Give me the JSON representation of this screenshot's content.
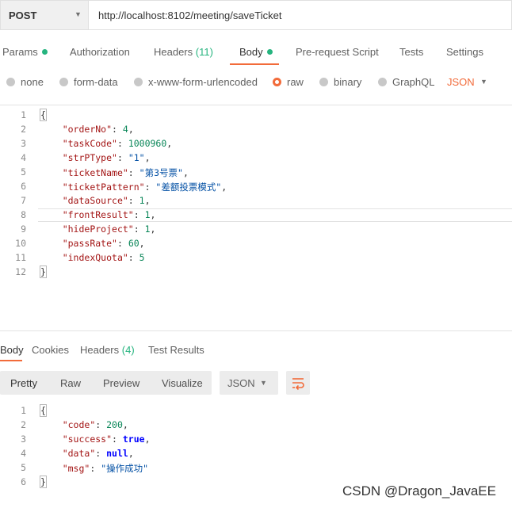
{
  "request": {
    "method": "POST",
    "url": "http://localhost:8102/meeting/saveTicket"
  },
  "tabs": {
    "params": "Params",
    "authorization": "Authorization",
    "headers_label": "Headers",
    "headers_count": "(11)",
    "body": "Body",
    "prerequest": "Pre-request Script",
    "tests": "Tests",
    "settings": "Settings"
  },
  "body_types": {
    "none": "none",
    "form_data": "form-data",
    "urlencoded": "x-www-form-urlencoded",
    "raw": "raw",
    "binary": "binary",
    "graphql": "GraphQL",
    "selected": "raw",
    "format": "JSON"
  },
  "request_body": [
    {
      "n": "1",
      "tokens": [
        {
          "t": "{",
          "c": "tk-p",
          "box": true
        }
      ]
    },
    {
      "n": "2",
      "tokens": [
        {
          "t": "    ",
          "c": "tk-p"
        },
        {
          "t": "\"orderNo\"",
          "c": "tk-key"
        },
        {
          "t": ": ",
          "c": "tk-p"
        },
        {
          "t": "4",
          "c": "tk-num"
        },
        {
          "t": ",",
          "c": "tk-p"
        }
      ]
    },
    {
      "n": "3",
      "tokens": [
        {
          "t": "    ",
          "c": "tk-p"
        },
        {
          "t": "\"taskCode\"",
          "c": "tk-key"
        },
        {
          "t": ": ",
          "c": "tk-p"
        },
        {
          "t": "1000960",
          "c": "tk-num"
        },
        {
          "t": ",",
          "c": "tk-p"
        }
      ]
    },
    {
      "n": "4",
      "tokens": [
        {
          "t": "    ",
          "c": "tk-p"
        },
        {
          "t": "\"strPType\"",
          "c": "tk-key"
        },
        {
          "t": ": ",
          "c": "tk-p"
        },
        {
          "t": "\"1\"",
          "c": "tk-str"
        },
        {
          "t": ",",
          "c": "tk-p"
        }
      ]
    },
    {
      "n": "5",
      "tokens": [
        {
          "t": "    ",
          "c": "tk-p"
        },
        {
          "t": "\"ticketName\"",
          "c": "tk-key"
        },
        {
          "t": ": ",
          "c": "tk-p"
        },
        {
          "t": "\"第3号票\"",
          "c": "tk-str"
        },
        {
          "t": ",",
          "c": "tk-p"
        }
      ]
    },
    {
      "n": "6",
      "tokens": [
        {
          "t": "    ",
          "c": "tk-p"
        },
        {
          "t": "\"ticketPattern\"",
          "c": "tk-key"
        },
        {
          "t": ": ",
          "c": "tk-p"
        },
        {
          "t": "\"差额投票模式\"",
          "c": "tk-str"
        },
        {
          "t": ",",
          "c": "tk-p"
        }
      ]
    },
    {
      "n": "7",
      "tokens": [
        {
          "t": "    ",
          "c": "tk-p"
        },
        {
          "t": "\"dataSource\"",
          "c": "tk-key"
        },
        {
          "t": ": ",
          "c": "tk-p"
        },
        {
          "t": "1",
          "c": "tk-num"
        },
        {
          "t": ",",
          "c": "tk-p"
        }
      ]
    },
    {
      "n": "8",
      "tokens": [
        {
          "t": "    ",
          "c": "tk-p"
        },
        {
          "t": "\"frontResult\"",
          "c": "tk-key"
        },
        {
          "t": ": ",
          "c": "tk-p"
        },
        {
          "t": "1",
          "c": "tk-num"
        },
        {
          "t": ",",
          "c": "tk-p"
        }
      ],
      "highlight": true
    },
    {
      "n": "9",
      "tokens": [
        {
          "t": "    ",
          "c": "tk-p"
        },
        {
          "t": "\"hideProject\"",
          "c": "tk-key"
        },
        {
          "t": ": ",
          "c": "tk-p"
        },
        {
          "t": "1",
          "c": "tk-num"
        },
        {
          "t": ",",
          "c": "tk-p"
        }
      ]
    },
    {
      "n": "10",
      "tokens": [
        {
          "t": "    ",
          "c": "tk-p"
        },
        {
          "t": "\"passRate\"",
          "c": "tk-key"
        },
        {
          "t": ": ",
          "c": "tk-p"
        },
        {
          "t": "60",
          "c": "tk-num"
        },
        {
          "t": ",",
          "c": "tk-p"
        }
      ]
    },
    {
      "n": "11",
      "tokens": [
        {
          "t": "    ",
          "c": "tk-p"
        },
        {
          "t": "\"indexQuota\"",
          "c": "tk-key"
        },
        {
          "t": ": ",
          "c": "tk-p"
        },
        {
          "t": "5",
          "c": "tk-num"
        }
      ]
    },
    {
      "n": "12",
      "tokens": [
        {
          "t": "}",
          "c": "tk-p",
          "box": true
        }
      ]
    }
  ],
  "response_tabs": {
    "body": "Body",
    "cookies": "Cookies",
    "headers_label": "Headers",
    "headers_count": "(4)",
    "test_results": "Test Results"
  },
  "response_toolbar": {
    "pretty": "Pretty",
    "raw": "Raw",
    "preview": "Preview",
    "visualize": "Visualize",
    "format": "JSON",
    "wrap_icon": "wrap-lines-icon"
  },
  "response_body": [
    {
      "n": "1",
      "tokens": [
        {
          "t": "{",
          "c": "tk-p",
          "box": true
        }
      ]
    },
    {
      "n": "2",
      "tokens": [
        {
          "t": "    ",
          "c": "tk-p"
        },
        {
          "t": "\"code\"",
          "c": "tk-key"
        },
        {
          "t": ": ",
          "c": "tk-p"
        },
        {
          "t": "200",
          "c": "tk-num"
        },
        {
          "t": ",",
          "c": "tk-p"
        }
      ]
    },
    {
      "n": "3",
      "tokens": [
        {
          "t": "    ",
          "c": "tk-p"
        },
        {
          "t": "\"success\"",
          "c": "tk-key"
        },
        {
          "t": ": ",
          "c": "tk-p"
        },
        {
          "t": "true",
          "c": "tk-kw"
        },
        {
          "t": ",",
          "c": "tk-p"
        }
      ]
    },
    {
      "n": "4",
      "tokens": [
        {
          "t": "    ",
          "c": "tk-p"
        },
        {
          "t": "\"data\"",
          "c": "tk-key"
        },
        {
          "t": ": ",
          "c": "tk-p"
        },
        {
          "t": "null",
          "c": "tk-kw"
        },
        {
          "t": ",",
          "c": "tk-p"
        }
      ]
    },
    {
      "n": "5",
      "tokens": [
        {
          "t": "    ",
          "c": "tk-p"
        },
        {
          "t": "\"msg\"",
          "c": "tk-key"
        },
        {
          "t": ": ",
          "c": "tk-p"
        },
        {
          "t": "\"操作成功\"",
          "c": "tk-str"
        }
      ]
    },
    {
      "n": "6",
      "tokens": [
        {
          "t": "}",
          "c": "tk-p",
          "box": true
        }
      ]
    }
  ],
  "watermark": "CSDN @Dragon_JavaEE",
  "colors": {
    "accent": "#f26b3a",
    "success": "#26b47f"
  }
}
